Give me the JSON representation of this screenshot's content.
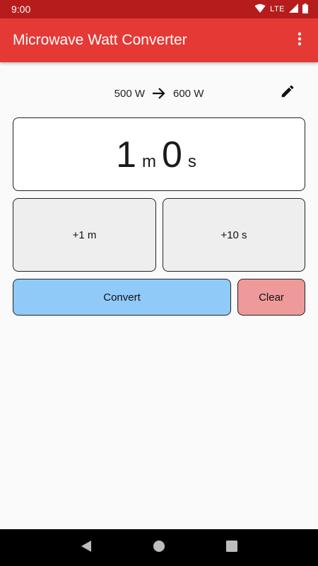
{
  "status_bar": {
    "time": "9:00",
    "network": "LTE"
  },
  "app_bar": {
    "title": "Microwave Watt Converter"
  },
  "wattage": {
    "from": "500 W",
    "to": "600 W"
  },
  "timer": {
    "minutes": "1",
    "minutes_unit": "m",
    "seconds": "0",
    "seconds_unit": "s"
  },
  "buttons": {
    "add_minute": "+1 m",
    "add_seconds": "+10 s",
    "convert": "Convert",
    "clear": "Clear"
  },
  "colors": {
    "status_bar": "#b71c1c",
    "app_bar": "#e53935",
    "convert": "#90caf9",
    "clear": "#ef9a9a",
    "increment": "#eeeeee"
  },
  "icons": [
    "wifi-icon",
    "signal-icon",
    "battery-icon",
    "overflow-menu-icon",
    "arrow-right-icon",
    "edit-pencil-icon",
    "nav-back-icon",
    "nav-home-icon",
    "nav-recents-icon"
  ]
}
